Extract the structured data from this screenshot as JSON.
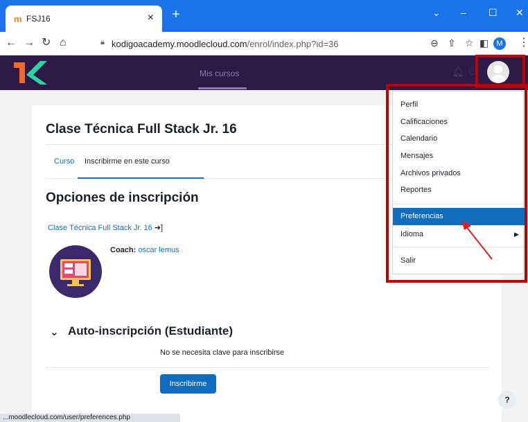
{
  "browser": {
    "tab_favicon": "m",
    "tab_title": "FSJ16",
    "url_host": "kodigoacademy.moodlecloud.com",
    "url_path": "/enrol/index.php?id=36",
    "profile_letter": "M",
    "status_url": "...moodlecloud.com/user/preferences.php"
  },
  "navbar": {
    "links": [
      "",
      ""
    ],
    "active_link": "Mis cursos"
  },
  "course": {
    "title": "Clase Técnica Full Stack Jr. 16",
    "tabs": [
      "Curso",
      "Inscribirme en este curso"
    ],
    "section_title": "Opciones de inscripción",
    "link_text": "Clase Técnica Full Stack Jr. 16",
    "coach_label": "Coach:",
    "coach_name": "oscar lemus",
    "auto_title": "Auto-inscripción (Estudiante)",
    "no_key_text": "No se necesita clave para inscribirse",
    "enroll_button": "Inscribirme"
  },
  "user_menu": {
    "items": [
      "Perfil",
      "Calificaciones",
      "Calendario",
      "Mensajes",
      "Archivos privados",
      "Reportes"
    ],
    "selected": "Preferencias",
    "language": "Idioma",
    "logout": "Salir"
  },
  "help_label": "?",
  "colors": {
    "browser_blue": "#1a73e8",
    "navbar": "#2e1a47",
    "link_blue": "#0f6cbf",
    "highlight_red": "#c00000"
  }
}
